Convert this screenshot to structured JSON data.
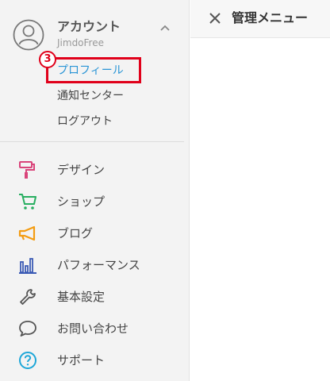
{
  "account": {
    "title": "アカウント",
    "plan": "JimdoFree",
    "submenu": [
      {
        "label": "プロフィール",
        "active": true
      },
      {
        "label": "通知センター",
        "active": false
      },
      {
        "label": "ログアウト",
        "active": false
      }
    ]
  },
  "annotation": {
    "step": "3",
    "color": "#e0001a"
  },
  "nav": [
    {
      "label": "デザイン",
      "icon": "paint-roller-icon",
      "color": "#d9447a"
    },
    {
      "label": "ショップ",
      "icon": "shopping-cart-icon",
      "color": "#27ae60"
    },
    {
      "label": "ブログ",
      "icon": "megaphone-icon",
      "color": "#f39c12"
    },
    {
      "label": "パフォーマンス",
      "icon": "bar-chart-icon",
      "color": "#3b5bb5"
    },
    {
      "label": "基本設定",
      "icon": "wrench-icon",
      "color": "#555555"
    },
    {
      "label": "お問い合わせ",
      "icon": "speech-bubble-icon",
      "color": "#555555"
    },
    {
      "label": "サポート",
      "icon": "question-circle-icon",
      "color": "#1ea7d8"
    }
  ],
  "topbar": {
    "title": "管理メニュー",
    "close_icon": "close-icon"
  }
}
